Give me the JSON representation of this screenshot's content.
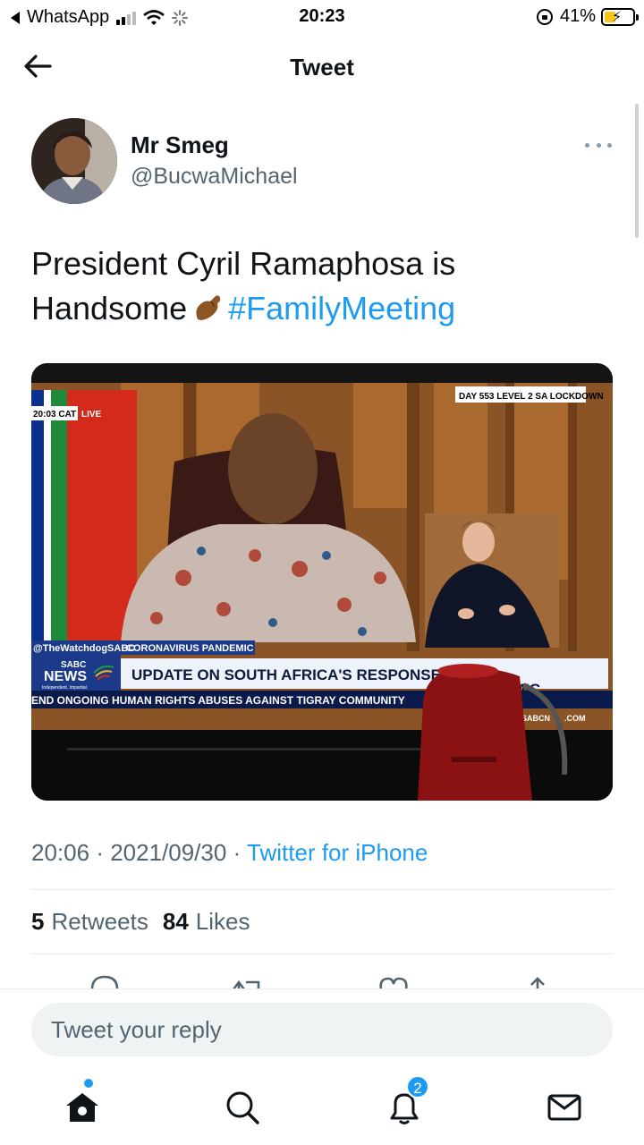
{
  "status_bar": {
    "back_app": "WhatsApp",
    "time": "20:23",
    "battery": "41%",
    "battery_level": 0.41
  },
  "header": {
    "title": "Tweet"
  },
  "tweet": {
    "author_name": "Mr Smeg",
    "author_handle": "@BucwaMichael",
    "text_line1": "President Cyril Ramaphosa is",
    "text_line2_prefix": "Handsome",
    "hashtag": "#FamilyMeeting",
    "media": {
      "clock": "20:03 CAT",
      "live": "LIVE",
      "day_banner": "DAY 553 LEVEL 2 SA LOCKDOWN",
      "handle_tag": "@TheWatchdogSABC",
      "topic": "CORONAVIRUS PANDEMIC",
      "brand_top": "SABC",
      "brand_main": "NEWS",
      "brand_tagline": "Independent. Impartial.",
      "headline": "UPDATE ON SOUTH AFRICA'S RESPONSE TO TH",
      "headline_end": "MIC",
      "ticker": "END ONGOING HUMAN RIGHTS ABUSES AGAINST TIGRAY COMMUNITY",
      "site_a": "SABCN",
      "site_b": ".COM"
    },
    "time": "20:06",
    "date": "2021/09/30",
    "separator": "·",
    "source": "Twitter for iPhone",
    "retweets_count": "5",
    "retweets_label": "Retweets",
    "likes_count": "84",
    "likes_label": "Likes"
  },
  "reply": {
    "placeholder": "Tweet your reply"
  },
  "tabs": {
    "notifications_badge": "2"
  },
  "colors": {
    "accent": "#1d9bf0",
    "text": "#0f1419",
    "muted": "#536471"
  }
}
